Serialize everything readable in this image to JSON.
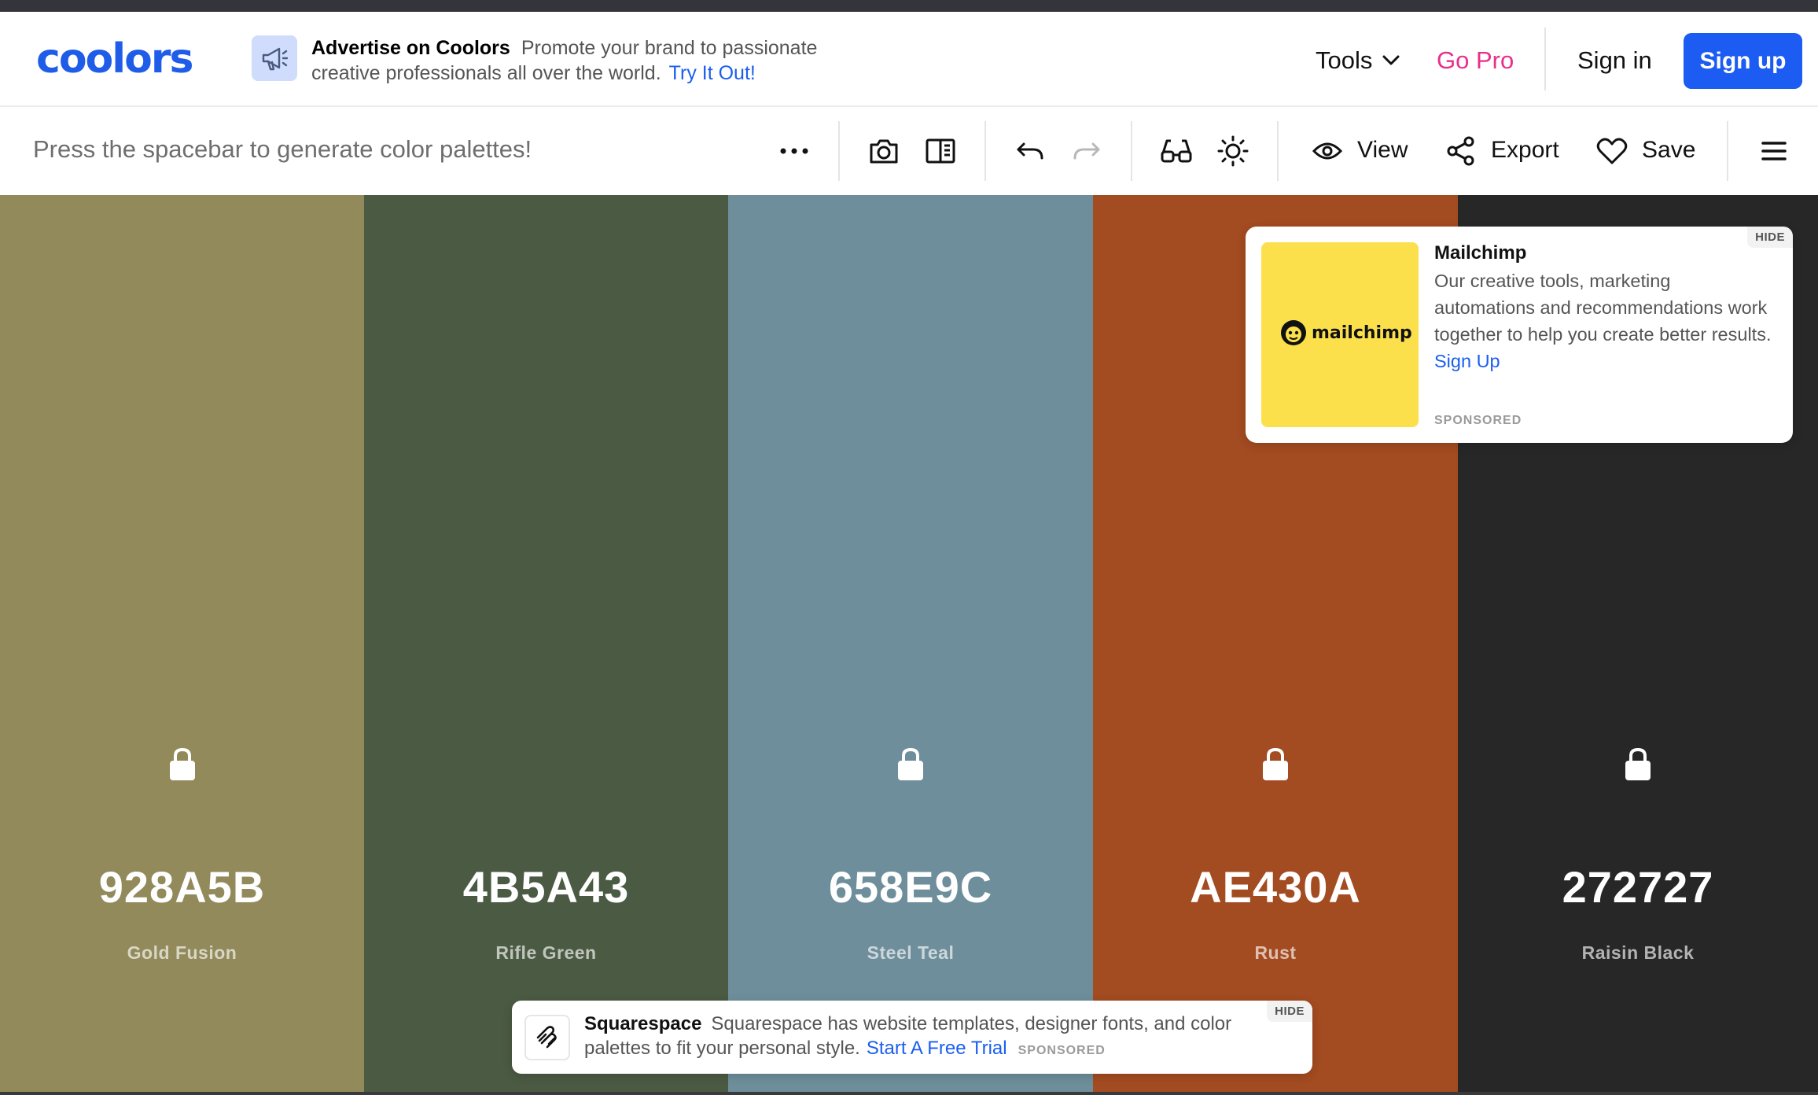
{
  "header": {
    "logo": "coolors",
    "ad": {
      "title": "Advertise on Coolors",
      "text": "Promote your brand to passionate creative professionals all over the world.",
      "link": "Try It Out!"
    },
    "nav": {
      "tools": "Tools",
      "go_pro": "Go Pro",
      "sign_in": "Sign in",
      "sign_up": "Sign up"
    }
  },
  "toolbar": {
    "hint": "Press the spacebar to generate color palettes!",
    "view_label": "View",
    "export_label": "Export",
    "save_label": "Save"
  },
  "palette": [
    {
      "hex": "928A5B",
      "name": "Gold Fusion",
      "color": "#928A5B",
      "locked": true
    },
    {
      "hex": "4B5A43",
      "name": "Rifle Green",
      "color": "#4B5A43",
      "locked": false
    },
    {
      "hex": "658E9C",
      "name": "Steel Teal",
      "color": "#6D8E9A",
      "locked": true
    },
    {
      "hex": "AE430A",
      "name": "Rust",
      "color": "#A34B21",
      "locked": true
    },
    {
      "hex": "272727",
      "name": "Raisin Black",
      "color": "#272727",
      "locked": true
    }
  ],
  "ads": {
    "mailchimp": {
      "hide": "HIDE",
      "logo_text": "mailchimp",
      "title": "Mailchimp",
      "body": "Our creative tools, marketing automations and recommendations work together to help you create better results.",
      "link": "Sign Up",
      "sponsored": "SPONSORED"
    },
    "squarespace": {
      "hide": "HIDE",
      "title": "Squarespace",
      "body": "Squarespace has website templates, designer fonts, and color palettes to fit your personal style.",
      "link": "Start A Free Trial",
      "sponsored": "SPONSORED"
    }
  },
  "colors": {
    "brand": "#1f5de9",
    "pro": "#e8308c",
    "link": "#1a5ef0"
  }
}
